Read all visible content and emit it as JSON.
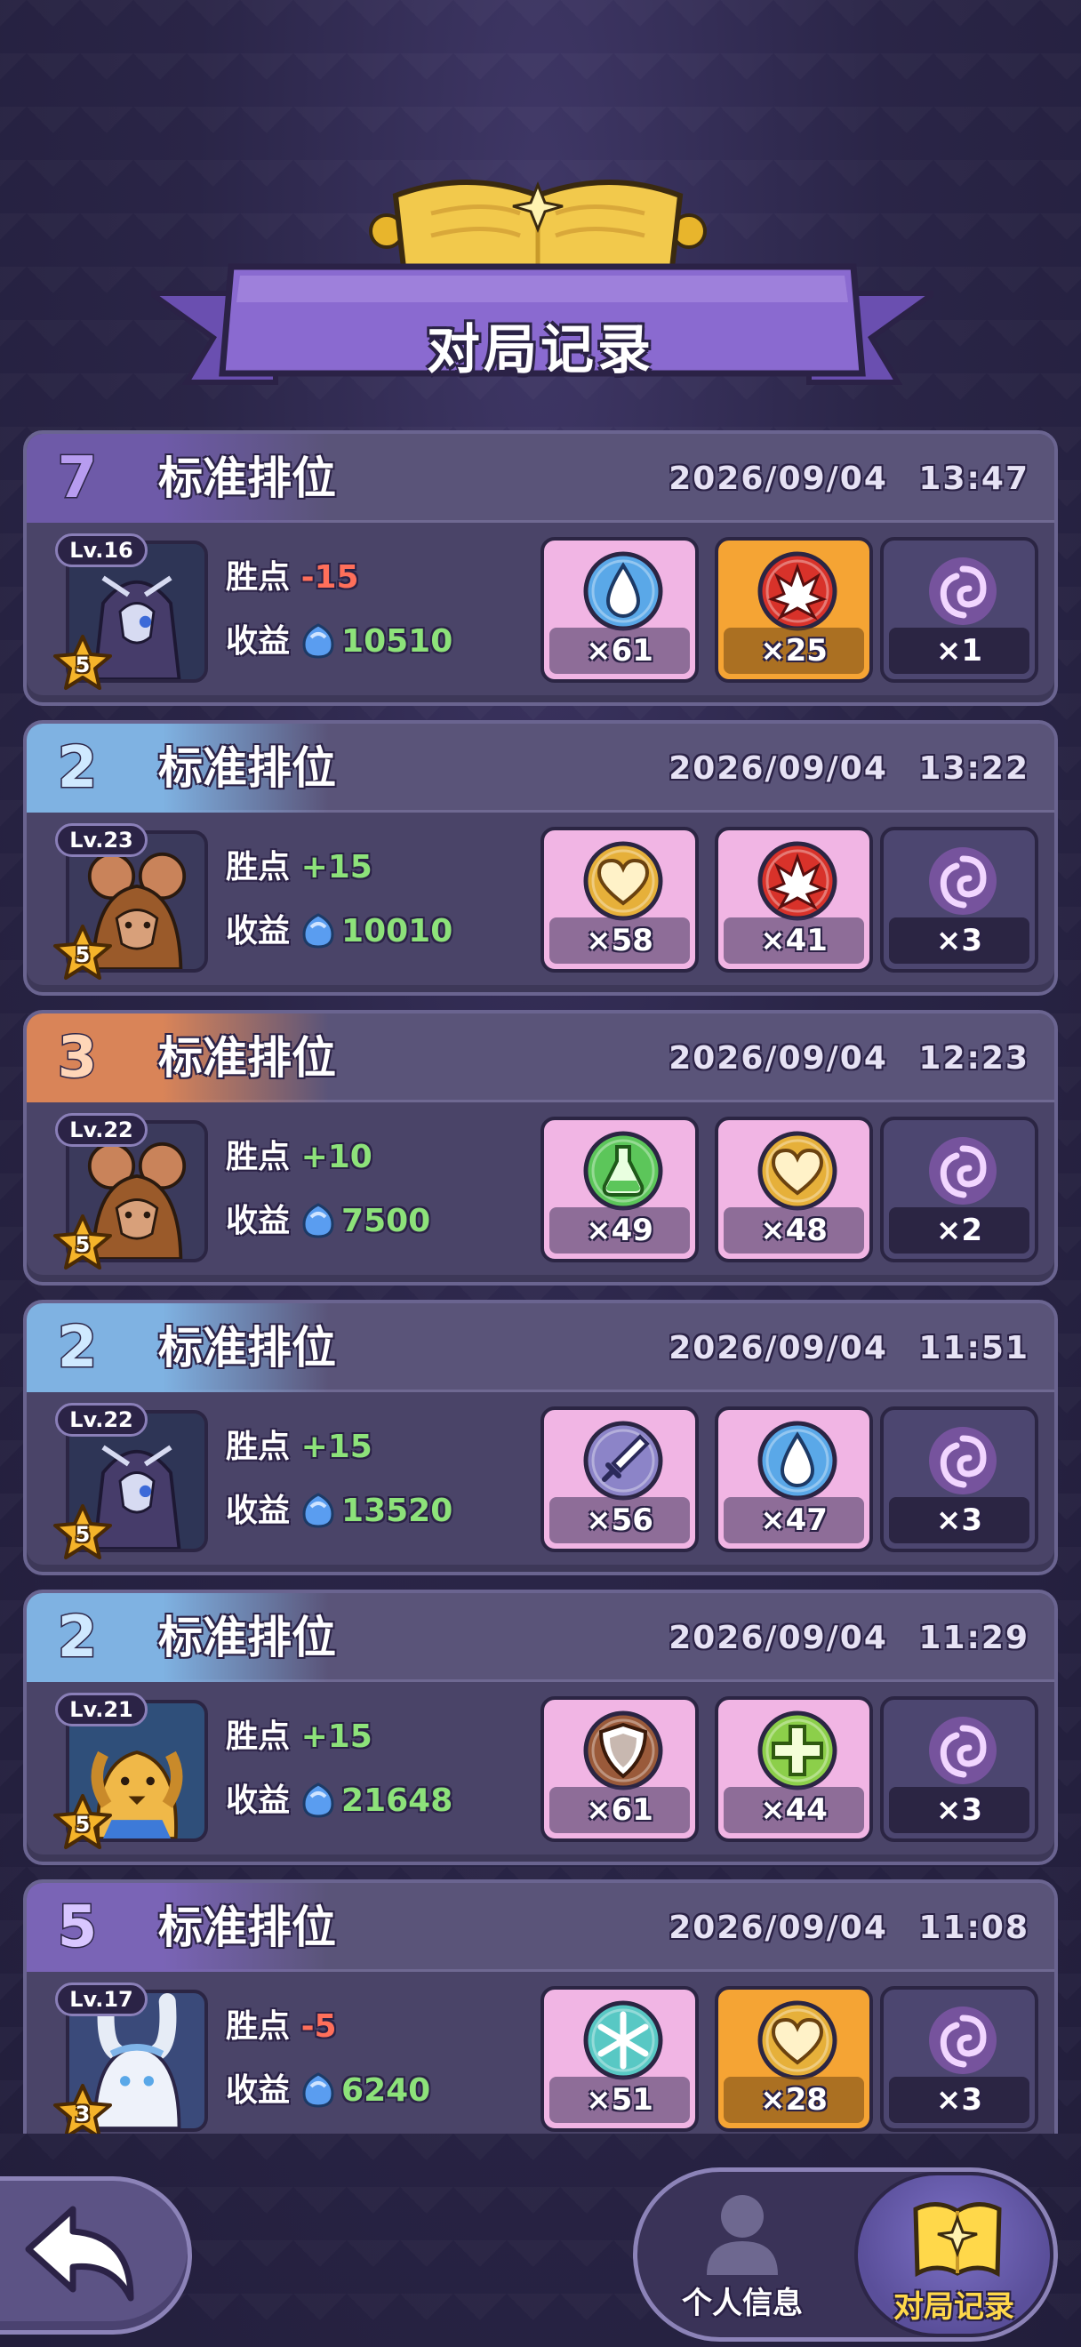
{
  "page": {
    "title": "对局记录"
  },
  "records": [
    {
      "rank": "7",
      "rank_color": "#b79cf0",
      "band_color": "#6e5aa8",
      "mode": "标准排位",
      "datetime": "2026/09/04   13:47",
      "level": "Lv.16",
      "stars": "5",
      "avatar": "dark-knight-portrait",
      "points_label": "胜点",
      "points": "-15",
      "points_sign": "neg",
      "income_label": "收益",
      "income": "10510",
      "items": [
        {
          "icon": "water-drop-icon",
          "count": "×61",
          "tile": "pink",
          "coin": "#5aa8e8"
        },
        {
          "icon": "flame-burst-icon",
          "count": "×25",
          "tile": "gold",
          "coin": "#d8322a"
        },
        {
          "icon": "purple-wisp-icon",
          "count": "×1",
          "tile": "dark",
          "coin": "#c56ef0"
        }
      ]
    },
    {
      "rank": "2",
      "rank_color": "#cfe9ff",
      "band_color": "#7fb2e2",
      "mode": "标准排位",
      "datetime": "2026/09/04   13:22",
      "level": "Lv.23",
      "stars": "5",
      "avatar": "hooded-mouse-portrait",
      "points_label": "胜点",
      "points": "+15",
      "points_sign": "pos",
      "income_label": "收益",
      "income": "10010",
      "items": [
        {
          "icon": "heart-icon",
          "count": "×58",
          "tile": "pink",
          "coin": "#e6b03a"
        },
        {
          "icon": "flame-burst-icon",
          "count": "×41",
          "tile": "pink",
          "coin": "#d8322a"
        },
        {
          "icon": "purple-wisp-icon",
          "count": "×3",
          "tile": "dark",
          "coin": "#c56ef0"
        }
      ]
    },
    {
      "rank": "3",
      "rank_color": "#ffd6b8",
      "band_color": "#d98458",
      "mode": "标准排位",
      "datetime": "2026/09/04   12:23",
      "level": "Lv.22",
      "stars": "5",
      "avatar": "hooded-mouse-portrait",
      "points_label": "胜点",
      "points": "+10",
      "points_sign": "pos",
      "income_label": "收益",
      "income": "7500",
      "items": [
        {
          "icon": "potion-flask-icon",
          "count": "×49",
          "tile": "pink",
          "coin": "#5cc65a"
        },
        {
          "icon": "heart-icon",
          "count": "×48",
          "tile": "pink",
          "coin": "#e6b03a"
        },
        {
          "icon": "purple-wisp-icon",
          "count": "×2",
          "tile": "dark",
          "coin": "#c56ef0"
        }
      ]
    },
    {
      "rank": "2",
      "rank_color": "#cfe9ff",
      "band_color": "#7fb2e2",
      "mode": "标准排位",
      "datetime": "2026/09/04   11:51",
      "level": "Lv.22",
      "stars": "5",
      "avatar": "dark-knight-portrait",
      "points_label": "胜点",
      "points": "+15",
      "points_sign": "pos",
      "income_label": "收益",
      "income": "13520",
      "items": [
        {
          "icon": "sword-icon",
          "count": "×56",
          "tile": "pink",
          "coin": "#8c84c8"
        },
        {
          "icon": "water-drop-icon",
          "count": "×47",
          "tile": "pink",
          "coin": "#5aa8e8"
        },
        {
          "icon": "purple-wisp-icon",
          "count": "×3",
          "tile": "dark",
          "coin": "#c56ef0"
        }
      ]
    },
    {
      "rank": "2",
      "rank_color": "#cfe9ff",
      "band_color": "#7fb2e2",
      "mode": "标准排位",
      "datetime": "2026/09/04   11:29",
      "level": "Lv.21",
      "stars": "5",
      "avatar": "golden-dog-portrait",
      "points_label": "胜点",
      "points": "+15",
      "points_sign": "pos",
      "income_label": "收益",
      "income": "21648",
      "items": [
        {
          "icon": "shield-icon",
          "count": "×61",
          "tile": "pink",
          "coin": "#9a5a3a"
        },
        {
          "icon": "plus-cross-icon",
          "count": "×44",
          "tile": "pink",
          "coin": "#8ccf4a"
        },
        {
          "icon": "purple-wisp-icon",
          "count": "×3",
          "tile": "dark",
          "coin": "#c56ef0"
        }
      ]
    },
    {
      "rank": "5",
      "rank_color": "#d8c6ff",
      "band_color": "#7a64b6",
      "mode": "标准排位",
      "datetime": "2026/09/04   11:08",
      "level": "Lv.17",
      "stars": "3",
      "avatar": "white-rabbit-portrait",
      "points_label": "胜点",
      "points": "-5",
      "points_sign": "neg",
      "income_label": "收益",
      "income": "6240",
      "items": [
        {
          "icon": "snowflake-icon",
          "count": "×51",
          "tile": "pink",
          "coin": "#58c8c4"
        },
        {
          "icon": "heart-icon",
          "count": "×28",
          "tile": "gold",
          "coin": "#e6b03a"
        },
        {
          "icon": "purple-wisp-icon",
          "count": "×3",
          "tile": "dark",
          "coin": "#c56ef0"
        }
      ]
    }
  ],
  "nav": {
    "back_icon": "back-arrow-icon",
    "profile_label": "个人信息",
    "records_label": "对局记录"
  }
}
